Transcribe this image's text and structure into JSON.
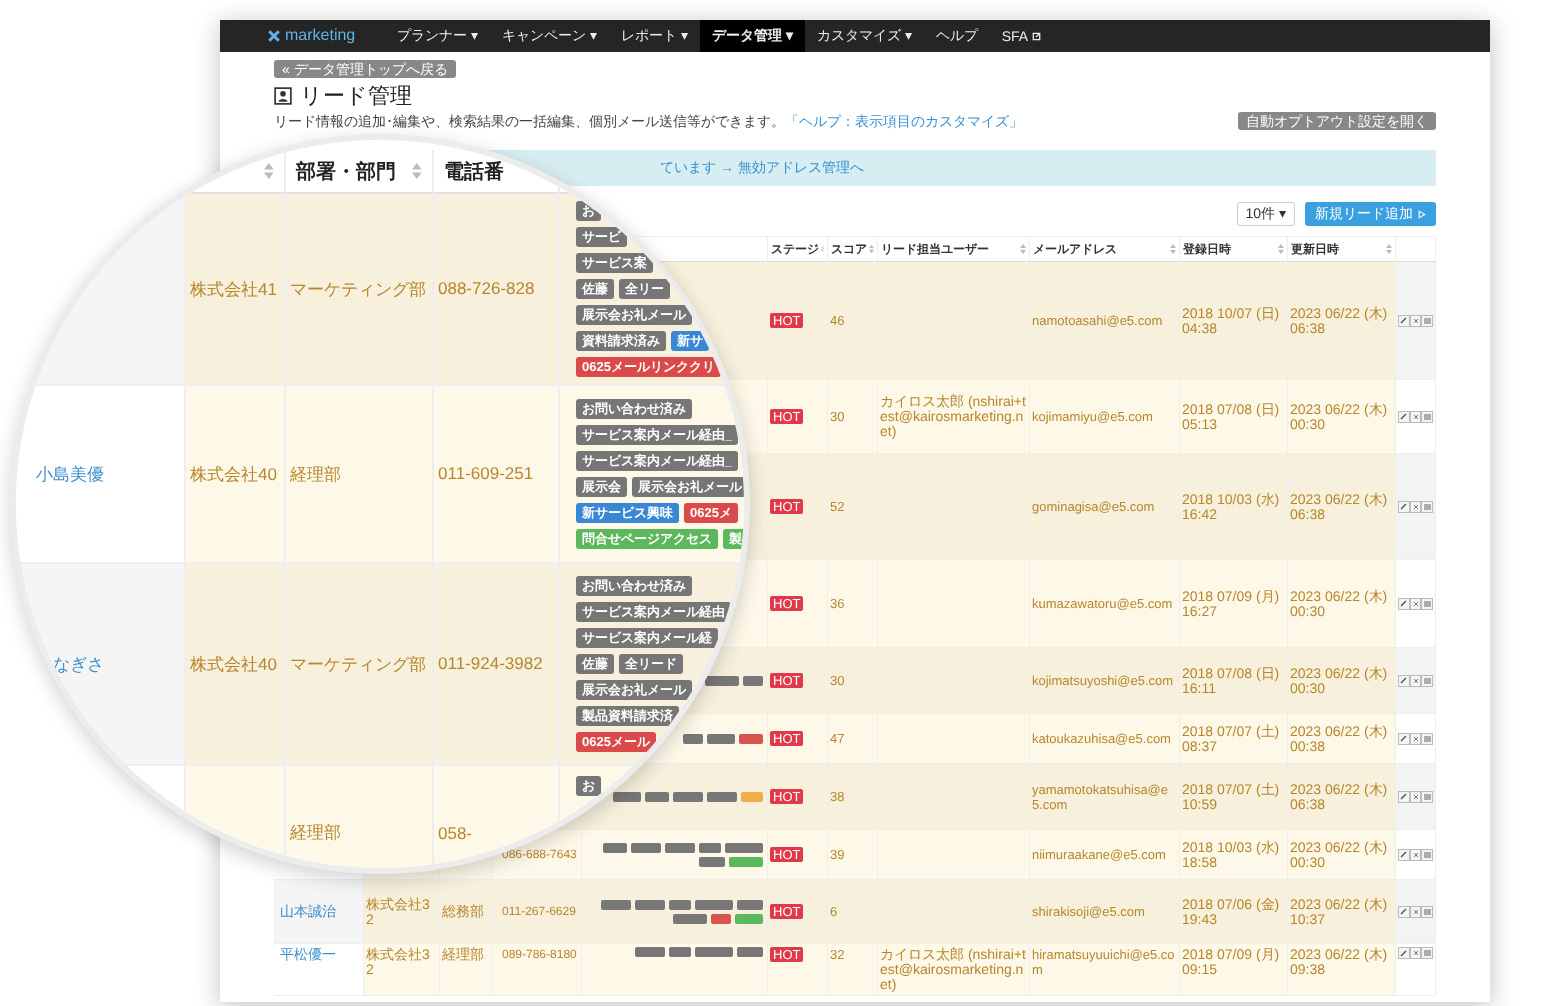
{
  "nav": {
    "logo": "marketing",
    "items": [
      {
        "label": "プランナー ▾",
        "selected": false,
        "external": false
      },
      {
        "label": "キャンペーン ▾",
        "selected": false,
        "external": false
      },
      {
        "label": "レポート ▾",
        "selected": false,
        "external": false
      },
      {
        "label": "データ管理 ▾",
        "selected": true,
        "external": false
      },
      {
        "label": "カスタマイズ ▾",
        "selected": false,
        "external": false
      },
      {
        "label": "ヘルプ",
        "selected": false,
        "external": false
      },
      {
        "label": "SFA",
        "selected": false,
        "external": true
      }
    ]
  },
  "back_button": "« データ管理トップへ戻る",
  "title": "リード管理",
  "description": "リード情報の追加･編集や、検索結果の一括編集、個別メール送信等ができます。",
  "help_link": "「ヘルプ：表示項目のカスタマイズ」",
  "optout_button": "自動オプトアウト設定を開く",
  "notice": "ています → 無効アドレス管理へ",
  "page_size": "10件 ▾",
  "add_button": "新規リード追加",
  "table": {
    "columns": [
      "ステージ",
      "スコア",
      "リード担当ユーザー",
      "メールアドレス",
      "登録日時",
      "更新日時"
    ],
    "rows": [
      {
        "stage": "HOT",
        "score": "46",
        "email": "namotoasahi@e5.com",
        "registered": "2018 10/07 (日) 04:38",
        "updated": "2023 06/22 (木) 06:38",
        "tags": []
      },
      {
        "stage": "HOT",
        "score": "30",
        "user": "カイロス太郎 (nshirai+test@kairosmarketing.net)",
        "email": "kojimamiyu@e5.com",
        "registered": "2018 07/08 (日) 05:13",
        "updated": "2023 06/22 (木) 00:30",
        "tags": []
      },
      {
        "stage": "HOT",
        "score": "52",
        "email": "gominagisa@e5.com",
        "registered": "2018 10/03 (水) 16:42",
        "updated": "2023 06/22 (木) 06:38",
        "tags": []
      },
      {
        "stage": "HOT",
        "score": "36",
        "email": "kumazawatoru@e5.com",
        "registered": "2018 07/09 (月) 16:27",
        "updated": "2023 06/22 (木) 00:30",
        "tags": []
      },
      {
        "stage": "HOT",
        "score": "30",
        "email": "kojimatsuyoshi@e5.com",
        "registered": "2018 07/08 (日) 16:11",
        "updated": "2023 06/22 (木) 00:30",
        "tags": [
          {
            "color": "#777777"
          },
          {
            "color": "#777777"
          }
        ]
      },
      {
        "stage": "HOT",
        "score": "47",
        "email": "katoukazuhisa@e5.com",
        "registered": "2018 07/07 (土) 08:37",
        "updated": "2023 06/22 (木) 00:38",
        "tags": [
          {
            "color": "#777777"
          },
          {
            "color": "#777777"
          },
          {
            "color": "#d9534f"
          }
        ]
      },
      {
        "stage": "HOT",
        "score": "38",
        "email": "yamamotokatsuhisa@e5.com",
        "registered": "2018 07/07 (土) 10:59",
        "updated": "2023 06/22 (木) 06:38",
        "tags": [
          {
            "color": "#777777"
          },
          {
            "color": "#777777"
          },
          {
            "color": "#777777"
          },
          {
            "color": "#777777"
          },
          {
            "color": "#f0ad4e"
          }
        ]
      },
      {
        "phone": "086-688-7643",
        "stage": "HOT",
        "score": "39",
        "email": "niimuraakane@e5.com",
        "registered": "2018 10/03 (水) 18:58",
        "updated": "2023 06/22 (木) 00:30",
        "tags": [
          {
            "color": "#777777"
          },
          {
            "color": "#777777"
          },
          {
            "color": "#777777"
          },
          {
            "color": "#777777"
          },
          {
            "color": "#777777"
          },
          {
            "color": "#777777"
          },
          {
            "color": "#5cb85c"
          }
        ]
      },
      {
        "name": "山本誠治",
        "company": "株式会社32",
        "department": "総務部",
        "phone": "011-267-6629",
        "stage": "HOT",
        "score": "6",
        "email": "shirakisoji@e5.com",
        "registered": "2018 07/06 (金) 19:43",
        "updated": "2023 06/22 (木) 10:37",
        "tags": [
          {
            "color": "#777777"
          },
          {
            "color": "#777777"
          },
          {
            "color": "#777777"
          },
          {
            "color": "#777777"
          },
          {
            "color": "#777777"
          },
          {
            "color": "#777777"
          },
          {
            "color": "#d9534f"
          },
          {
            "color": "#5cb85c"
          }
        ]
      },
      {
        "name": "平松優一",
        "company": "株式会社32",
        "department": "経理部",
        "phone": "089-786-8180",
        "stage": "HOT",
        "score": "32",
        "user": "カイロス太郎 (nshirai+test@kairosmarketing.net)",
        "email": "hiramatsuyuuichi@e5.com",
        "registered": "2018 07/09 (月) 09:15",
        "updated": "2023 06/22 (木) 09:38",
        "tags": [
          {
            "color": "#777777"
          },
          {
            "color": "#777777"
          },
          {
            "color": "#777777"
          },
          {
            "color": "#777777"
          }
        ]
      }
    ]
  },
  "magnifier": {
    "columns": [
      "部署・部門",
      "電話番"
    ],
    "rows": [
      {
        "company": "株式会社41",
        "department": "マーケティング部",
        "phone": "088-726-828",
        "tag_lines": [
          [
            {
              "label": "お",
              "color": "#767676"
            }
          ],
          [
            {
              "label": "サービ",
              "color": "#767676"
            }
          ],
          [
            {
              "label": "サービス案",
              "color": "#767676"
            }
          ],
          [
            {
              "label": "佐藤",
              "color": "#767676"
            },
            {
              "label": "全リー",
              "color": "#767676"
            }
          ],
          [
            {
              "label": "展示会お礼メール",
              "color": "#767676"
            }
          ],
          [
            {
              "label": "資料請求済み",
              "color": "#767676"
            },
            {
              "label": "新サ",
              "color": "#3a87d6"
            }
          ],
          [
            {
              "label": "0625メールリンククリ",
              "color": "#db4a4a"
            }
          ]
        ]
      },
      {
        "name": "小島美優",
        "company": "株式会社40",
        "department": "経理部",
        "phone": "011-609-251",
        "tag_lines": [
          [
            {
              "label": "お問い合わせ済み",
              "color": "#767676"
            }
          ],
          [
            {
              "label": "サービス案内メール経由_",
              "color": "#767676"
            }
          ],
          [
            {
              "label": "サービス案内メール経由_",
              "color": "#767676"
            }
          ],
          [
            {
              "label": "展示会",
              "color": "#767676"
            },
            {
              "label": "展示会お礼メール",
              "color": "#767676"
            }
          ],
          [
            {
              "label": "新サービス興味",
              "color": "#3a87d6"
            },
            {
              "label": "0625メ",
              "color": "#db4a4a"
            }
          ],
          [
            {
              "label": "問合せページアクセス",
              "color": "#5cb85c"
            },
            {
              "label": "製",
              "color": "#5cb85c"
            }
          ]
        ]
      },
      {
        "name": "なぎさ",
        "company": "株式会社40",
        "department": "マーケティング部",
        "phone": "011-924-3982",
        "tag_lines": [
          [
            {
              "label": "お問い合わせ済み",
              "color": "#767676"
            }
          ],
          [
            {
              "label": "サービス案内メール経由",
              "color": "#767676"
            }
          ],
          [
            {
              "label": "サービス案内メール経",
              "color": "#767676"
            }
          ],
          [
            {
              "label": "佐藤",
              "color": "#767676"
            },
            {
              "label": "全リード",
              "color": "#767676"
            }
          ],
          [
            {
              "label": "展示会お礼メール",
              "color": "#767676"
            }
          ],
          [
            {
              "label": "製品資料請求済",
              "color": "#767676"
            }
          ],
          [
            {
              "label": "0625メール",
              "color": "#db4a4a"
            }
          ]
        ]
      },
      {
        "department": "経理部",
        "phone": "058-",
        "tag_lines": [
          [
            {
              "label": "お",
              "color": "#767676"
            }
          ]
        ]
      }
    ]
  }
}
